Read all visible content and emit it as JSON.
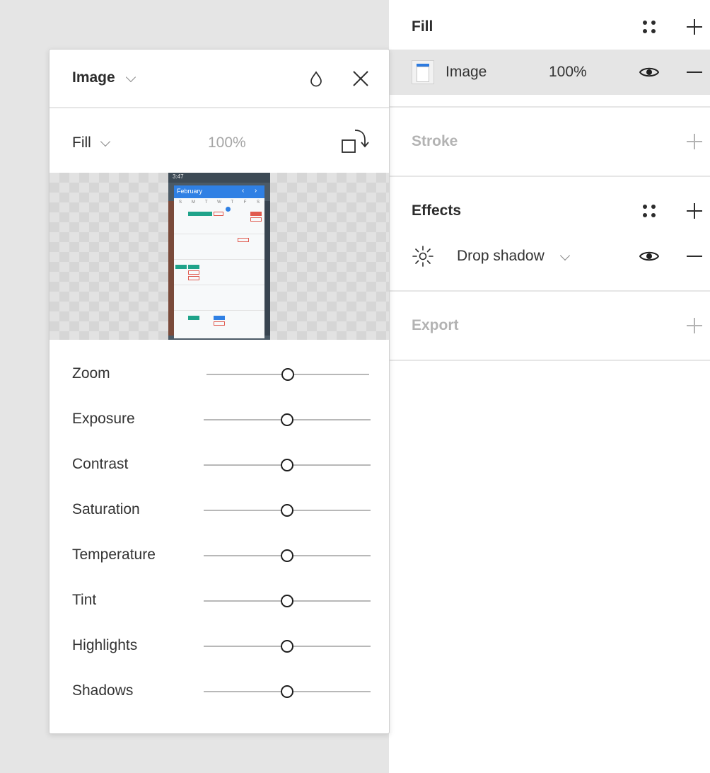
{
  "properties": {
    "fill": {
      "title": "Fill",
      "layer": {
        "type_label": "Image",
        "opacity": "100%"
      }
    },
    "stroke": {
      "title": "Stroke"
    },
    "effects": {
      "title": "Effects",
      "effect": {
        "label": "Drop shadow"
      }
    },
    "export": {
      "title": "Export"
    }
  },
  "popover": {
    "title": "Image",
    "mode_label": "Fill",
    "opacity": "100%",
    "preview": {
      "status_time": "3:47",
      "calendar_month": "February",
      "weekdays": [
        "S",
        "M",
        "T",
        "W",
        "T",
        "F",
        "S"
      ]
    },
    "sliders": [
      {
        "label": "Zoom",
        "value": 0.5
      },
      {
        "label": "Exposure",
        "value": 0.5
      },
      {
        "label": "Contrast",
        "value": 0.5
      },
      {
        "label": "Saturation",
        "value": 0.5
      },
      {
        "label": "Temperature",
        "value": 0.5
      },
      {
        "label": "Tint",
        "value": 0.5
      },
      {
        "label": "Highlights",
        "value": 0.5
      },
      {
        "label": "Shadows",
        "value": 0.5
      }
    ]
  },
  "colors": {
    "accent_blue": "#2f80e4",
    "chip_green": "#1fa38a",
    "chip_red": "#e05a4f"
  }
}
